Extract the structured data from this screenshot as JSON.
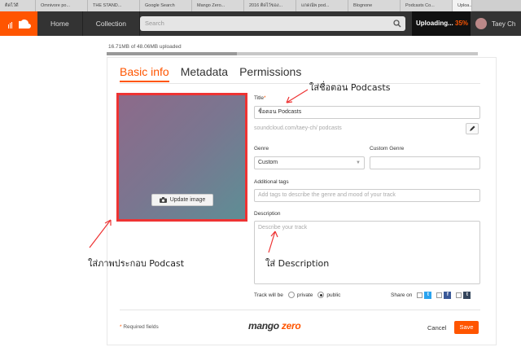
{
  "browser_tabs": [
    "ติดไว้ดี",
    "Omnivore po...",
    "THE STAND...",
    "Google Search",
    "Mango Zero...",
    "2016 ติดไว้ของ...",
    "แกดณ้พ pod...",
    "Blognone",
    "Podcasts Co...",
    "Uploa..."
  ],
  "header": {
    "nav": [
      "Home",
      "Collection"
    ],
    "search_placeholder": "Search",
    "upload_label": "Uploading...",
    "upload_pct": "35%",
    "username": "Taey Ch"
  },
  "progress": {
    "text": "16.71MB of 48.06MB uploaded",
    "fraction": 0.35
  },
  "tabs": [
    "Basic info",
    "Metadata",
    "Permissions"
  ],
  "artwork": {
    "button": "Update image"
  },
  "form": {
    "title_label": "Title",
    "title_value": "ชื่อตอน Podcasts",
    "url": "soundcloud.com/taey-ch/ podcasts",
    "genre_label": "Genre",
    "genre_value": "Custom",
    "custom_genre_label": "Custom Genre",
    "tags_label": "Additional tags",
    "tags_placeholder": "Add tags to describe the genre and mood of your track",
    "description_label": "Description",
    "description_placeholder": "Describe your track",
    "track_will_be": "Track will be",
    "private_label": "private",
    "public_label": "public",
    "share_on": "Share on",
    "required_note": "Required fields",
    "cancel": "Cancel",
    "save": "Save"
  },
  "brand": {
    "part1": "mango ",
    "part2": "zero"
  },
  "annotations": {
    "title_note": "ใส่ชื่อตอน Podcasts",
    "artwork_note": "ใส่ภาพประกอบ Podcast",
    "description_note": "ใส่ Description"
  },
  "colors": {
    "accent": "#ff5500",
    "header": "#333333",
    "annotation_red": "#e33333"
  }
}
